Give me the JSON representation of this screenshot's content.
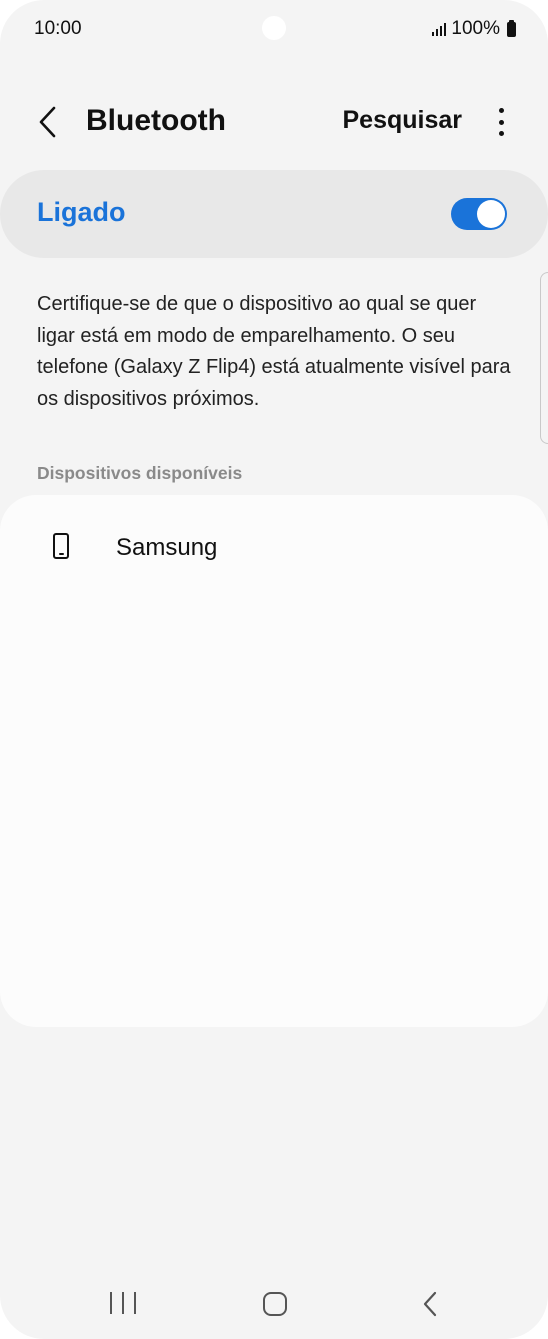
{
  "status_bar": {
    "time": "10:00",
    "battery": "100%",
    "signal_icon": "signal-icon",
    "battery_icon": "battery-icon"
  },
  "header": {
    "back_icon": "chevron-left-icon",
    "title": "Bluetooth",
    "search_label": "Pesquisar",
    "more_icon": "more-vertical-icon"
  },
  "master_toggle": {
    "label": "Ligado",
    "state": "on",
    "accent_color": "#1a73d9"
  },
  "description": "Certifique-se de que o dispositivo ao qual se quer ligar está em modo de emparelhamento. O seu telefone (Galaxy Z Flip4) está atualmente visível para os dispositivos próximos.",
  "available_devices": {
    "section_title": "Dispositivos disponíveis",
    "devices": [
      {
        "name": "Samsung",
        "icon": "phone-icon"
      }
    ]
  },
  "nav_bar": {
    "recents_icon": "recents-icon",
    "home_icon": "home-icon",
    "back_icon": "back-icon"
  }
}
